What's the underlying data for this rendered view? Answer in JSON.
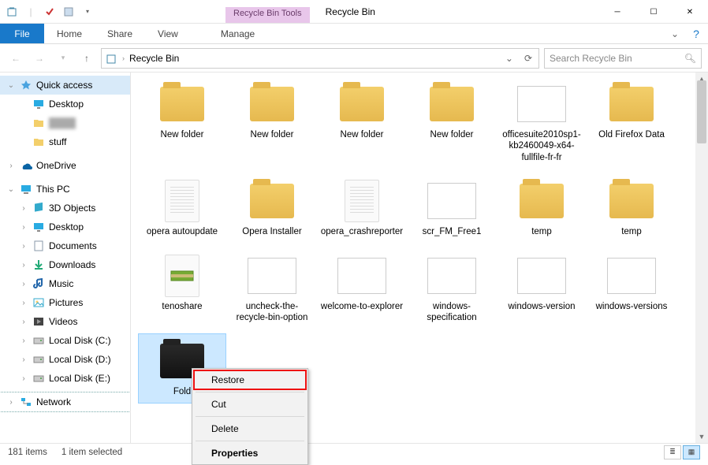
{
  "window": {
    "title": "Recycle Bin",
    "tools_tab": "Recycle Bin Tools"
  },
  "ribbon": {
    "file": "File",
    "tabs": [
      "Home",
      "Share",
      "View"
    ],
    "tools_tab": "Manage"
  },
  "address": {
    "location": "Recycle Bin"
  },
  "search": {
    "placeholder": "Search Recycle Bin"
  },
  "sidebar": {
    "quick_access": {
      "label": "Quick access",
      "items": [
        {
          "label": "Desktop",
          "icon": "desktop"
        },
        {
          "label": "",
          "icon": "folder",
          "blur": true
        },
        {
          "label": "stuff",
          "icon": "folder"
        }
      ]
    },
    "onedrive": {
      "label": "OneDrive"
    },
    "this_pc": {
      "label": "This PC",
      "items": [
        {
          "label": "3D Objects",
          "icon": "3d"
        },
        {
          "label": "Desktop",
          "icon": "desktop"
        },
        {
          "label": "Documents",
          "icon": "documents"
        },
        {
          "label": "Downloads",
          "icon": "downloads"
        },
        {
          "label": "Music",
          "icon": "music"
        },
        {
          "label": "Pictures",
          "icon": "pictures"
        },
        {
          "label": "Videos",
          "icon": "videos"
        },
        {
          "label": "Local Disk (C:)",
          "icon": "disk"
        },
        {
          "label": "Local Disk (D:)",
          "icon": "disk"
        },
        {
          "label": "Local Disk (E:)",
          "icon": "disk"
        }
      ]
    },
    "network": {
      "label": "Network"
    }
  },
  "items": [
    {
      "name": "New folder",
      "kind": "folder"
    },
    {
      "name": "New folder",
      "kind": "folder"
    },
    {
      "name": "New folder",
      "kind": "folder"
    },
    {
      "name": "New folder",
      "kind": "folder"
    },
    {
      "name": "officesuite2010sp1-kb2460049-x64-fullfile-fr-fr",
      "kind": "image"
    },
    {
      "name": "Old Firefox Data",
      "kind": "folder"
    },
    {
      "name": "opera autoupdate",
      "kind": "doc"
    },
    {
      "name": "Opera Installer",
      "kind": "folder"
    },
    {
      "name": "opera_crashreporter",
      "kind": "doc"
    },
    {
      "name": "scr_FM_Free1",
      "kind": "image"
    },
    {
      "name": "temp",
      "kind": "folder"
    },
    {
      "name": "temp",
      "kind": "folder"
    },
    {
      "name": "tenoshare",
      "kind": "archive"
    },
    {
      "name": "uncheck-the-recycle-bin-option",
      "kind": "image"
    },
    {
      "name": "welcome-to-explorer",
      "kind": "image"
    },
    {
      "name": "windows-specification",
      "kind": "image"
    },
    {
      "name": "windows-version",
      "kind": "image"
    },
    {
      "name": "windows-versions",
      "kind": "image"
    },
    {
      "name": "Fold",
      "kind": "folder-dark",
      "selected": true
    }
  ],
  "context_menu": {
    "restore": "Restore",
    "cut": "Cut",
    "delete": "Delete",
    "properties": "Properties"
  },
  "status": {
    "count": "181 items",
    "selection": "1 item selected"
  }
}
